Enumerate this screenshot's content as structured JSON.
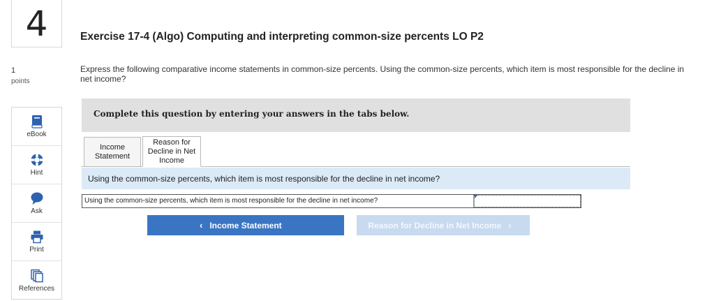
{
  "question": {
    "number": "4",
    "points_value": "1",
    "points_label": "points"
  },
  "toolbar": {
    "items": [
      {
        "label": "eBook",
        "icon": "ebook-icon"
      },
      {
        "label": "Hint",
        "icon": "hint-icon"
      },
      {
        "label": "Ask",
        "icon": "ask-icon"
      },
      {
        "label": "Print",
        "icon": "print-icon"
      },
      {
        "label": "References",
        "icon": "references-icon"
      }
    ]
  },
  "exercise": {
    "title": "Exercise 17-4 (Algo) Computing and interpreting common-size percents LO P2",
    "prompt": "Express the following comparative income statements in common-size percents. Using the common-size percents, which item is most responsible for the decline in net income?"
  },
  "instructions": "Complete this question by entering your answers in the tabs below.",
  "tabs": [
    {
      "label": "Income Statement",
      "active": false
    },
    {
      "label": "Reason for Decline in Net Income",
      "active": true
    }
  ],
  "question_band": "Using the common-size percents, which item is most responsible for the decline in net income?",
  "answer_row": {
    "label": "Using the common-size percents, which item is most responsible for the decline in net income?",
    "value": ""
  },
  "nav": {
    "prev_label": "Income Statement",
    "next_label": "Reason for Decline in Net Income"
  },
  "colors": {
    "primary_button": "#3a75c4",
    "disabled_button": "#c7daf0",
    "question_band": "#dbeaf6",
    "instruction_bar": "#e0e0e0",
    "icon_blue": "#2e62b0"
  }
}
